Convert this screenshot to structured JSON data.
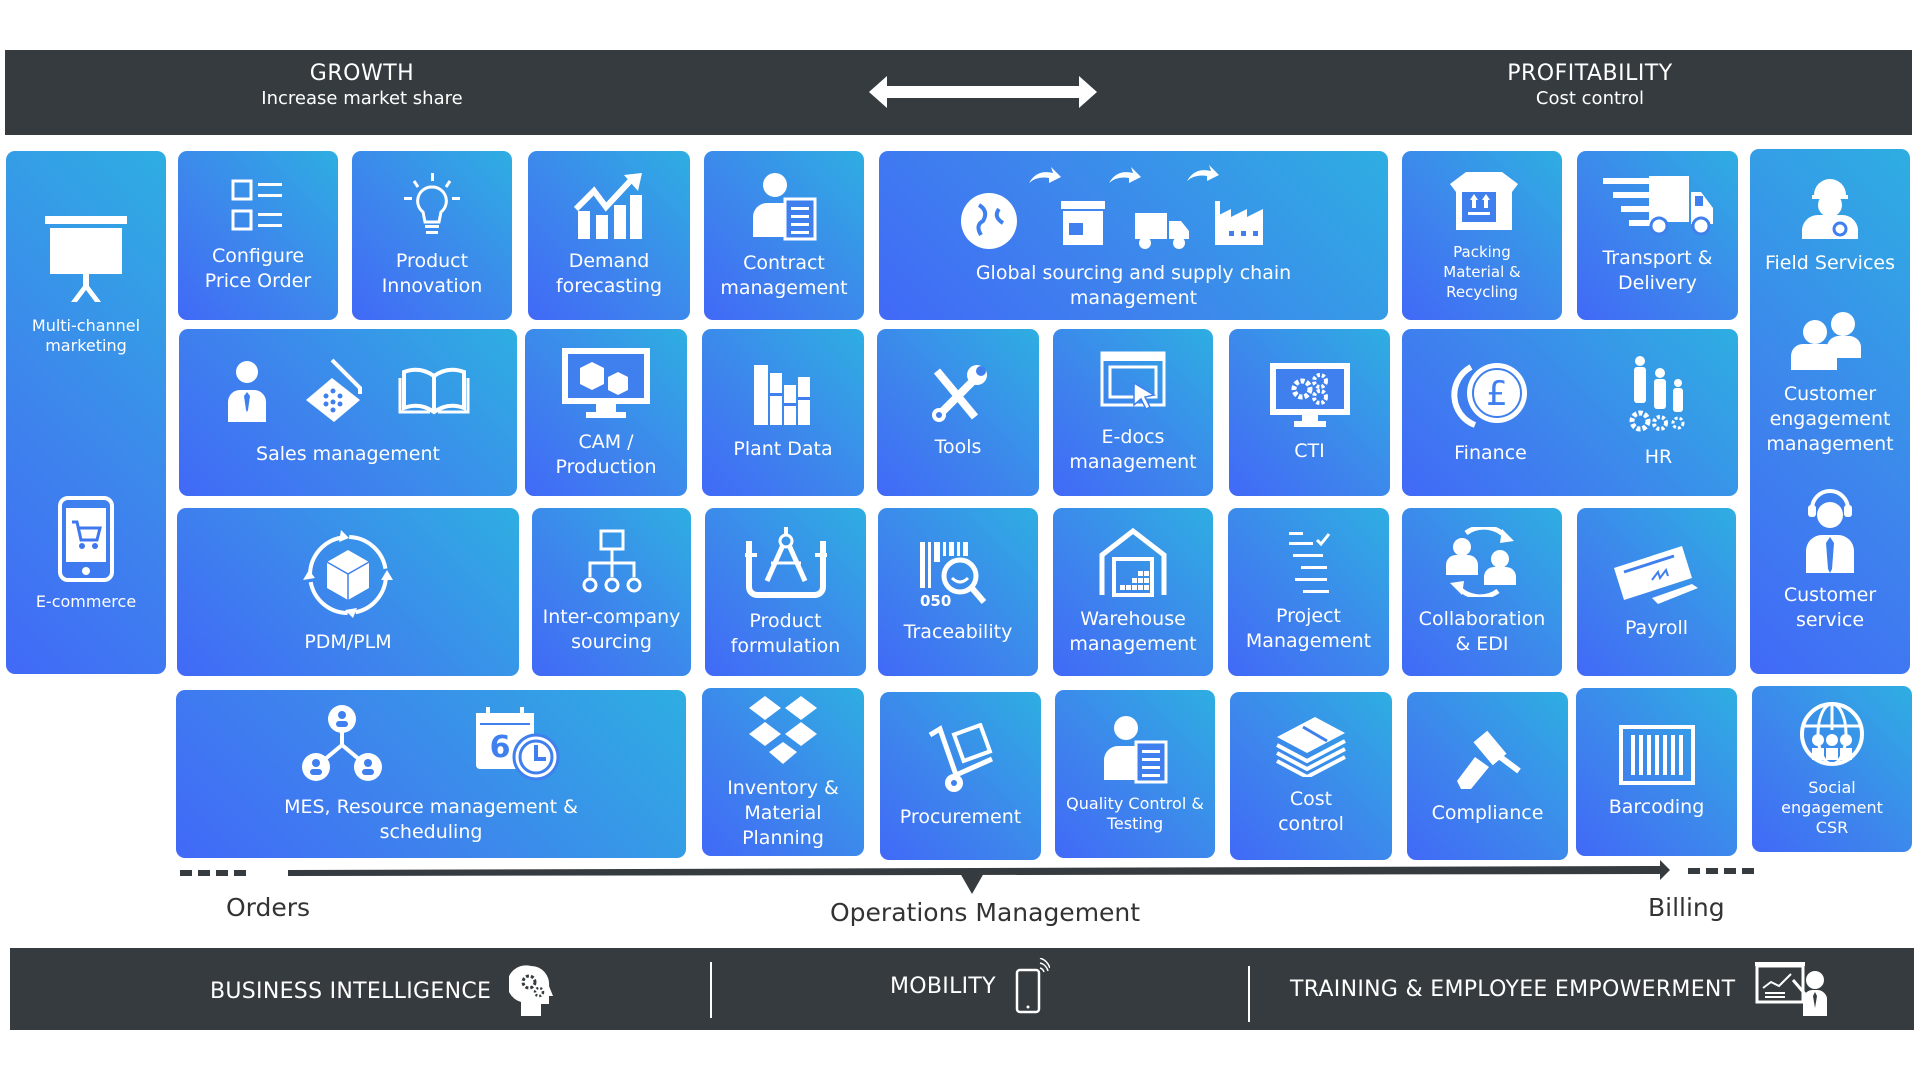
{
  "header": {
    "left": {
      "title": "GROWTH",
      "subtitle": "Increase market share"
    },
    "right": {
      "title": "PROFITABILITY",
      "subtitle": "Cost control"
    },
    "arrow_icon": "double-arrow-icon"
  },
  "tiles": {
    "multichannel": {
      "label": "Multi-channel\nmarketing",
      "icon": "presentation-board-icon"
    },
    "ecommerce": {
      "label": "E-commerce",
      "icon": "smartphone-cart-icon"
    },
    "configure": {
      "label": "Configure\nPrice Order",
      "icon": "checklist-icon"
    },
    "innovation": {
      "label": "Product\nInnovation",
      "icon": "lightbulb-icon"
    },
    "demand": {
      "label": "Demand\nforecasting",
      "icon": "growth-chart-icon"
    },
    "contract": {
      "label": "Contract\nmanagement",
      "icon": "person-document-icon"
    },
    "global": {
      "label": "Global sourcing and supply chain\nmanagement",
      "icons": [
        "globe-icon",
        "store-icon",
        "truck-icon",
        "factory-icon"
      ]
    },
    "packing": {
      "label": "Packing\nMaterial &\nRecycling",
      "icon": "box-icon"
    },
    "transport": {
      "label": "Transport &\nDelivery",
      "icon": "fast-truck-icon"
    },
    "field": {
      "label": "Field Services",
      "icon": "engineer-icon"
    },
    "sales": {
      "label": "Sales management",
      "icons": [
        "salesperson-icon",
        "laptop-icon",
        "book-icon"
      ]
    },
    "cam": {
      "label": "CAM /\nProduction",
      "icon": "monitor-cubes-icon"
    },
    "plant": {
      "label": "Plant Data",
      "icon": "binders-icon"
    },
    "tools": {
      "label": "Tools",
      "icon": "tools-icon"
    },
    "edocs": {
      "label": "E-docs\nmanagement",
      "icon": "browser-cursor-icon"
    },
    "cti": {
      "label": "CTI",
      "icon": "monitor-gears-icon"
    },
    "finance": {
      "label": "Finance",
      "icon": "pound-coins-icon"
    },
    "hr": {
      "label": "HR",
      "icon": "people-gears-icon"
    },
    "engagement": {
      "label": "Customer\nengagement\nmanagement",
      "icon": "two-people-icon"
    },
    "service": {
      "label": "Customer\nservice",
      "icon": "headset-agent-icon"
    },
    "pdm": {
      "label": "PDM/PLM",
      "icon": "cube-cycle-icon"
    },
    "intercompany": {
      "label": "Inter-company\nsourcing",
      "icon": "org-chart-icon"
    },
    "formulation": {
      "label": "Product\nformulation",
      "icon": "compass-blueprint-icon"
    },
    "traceability": {
      "label": "Traceability",
      "icon": "barcode-search-icon",
      "icon_text": "050"
    },
    "warehouse": {
      "label": "Warehouse\nmanagement",
      "icon": "warehouse-icon"
    },
    "project": {
      "label": "Project\nManagement",
      "icon": "task-list-icon"
    },
    "collaboration": {
      "label": "Collaboration\n& EDI",
      "icon": "people-exchange-icon"
    },
    "payroll": {
      "label": "Payroll",
      "icon": "cheque-pen-icon"
    },
    "mes": {
      "label": "MES, Resource management &\nscheduling",
      "icons": [
        "network-people-icon",
        "calendar-clock-icon"
      ],
      "calendar_text": "6"
    },
    "inventory": {
      "label": "Inventory &\nMaterial\nPlanning",
      "icon": "boxes-icon"
    },
    "procurement": {
      "label": "Procurement",
      "icon": "hand-truck-icon"
    },
    "quality": {
      "label": "Quality Control &\nTesting",
      "icon": "person-document-icon"
    },
    "cost": {
      "label": "Cost\ncontrol",
      "icon": "money-stack-icon"
    },
    "compliance": {
      "label": "Compliance",
      "icon": "gavel-icon"
    },
    "barcoding": {
      "label": "Barcoding",
      "icon": "barcode-icon"
    },
    "social": {
      "label": "Social\nengagement\nCSR",
      "icon": "globe-people-icon"
    }
  },
  "flow": {
    "start": "Orders",
    "middle": "Operations Management",
    "end": "Billing"
  },
  "footer": {
    "items": [
      {
        "label": "BUSINESS INTELLIGENCE",
        "icon": "head-gears-icon"
      },
      {
        "label": "MOBILITY",
        "icon": "mobile-signal-icon"
      },
      {
        "label": "TRAINING & EMPLOYEE EMPOWERMENT",
        "icon": "presenter-icon"
      }
    ]
  },
  "colors": {
    "band": "#353b3e",
    "tile_gradient_start": "#4169f7",
    "tile_gradient_end": "#2eaee2",
    "flow_line": "#353b3e"
  }
}
